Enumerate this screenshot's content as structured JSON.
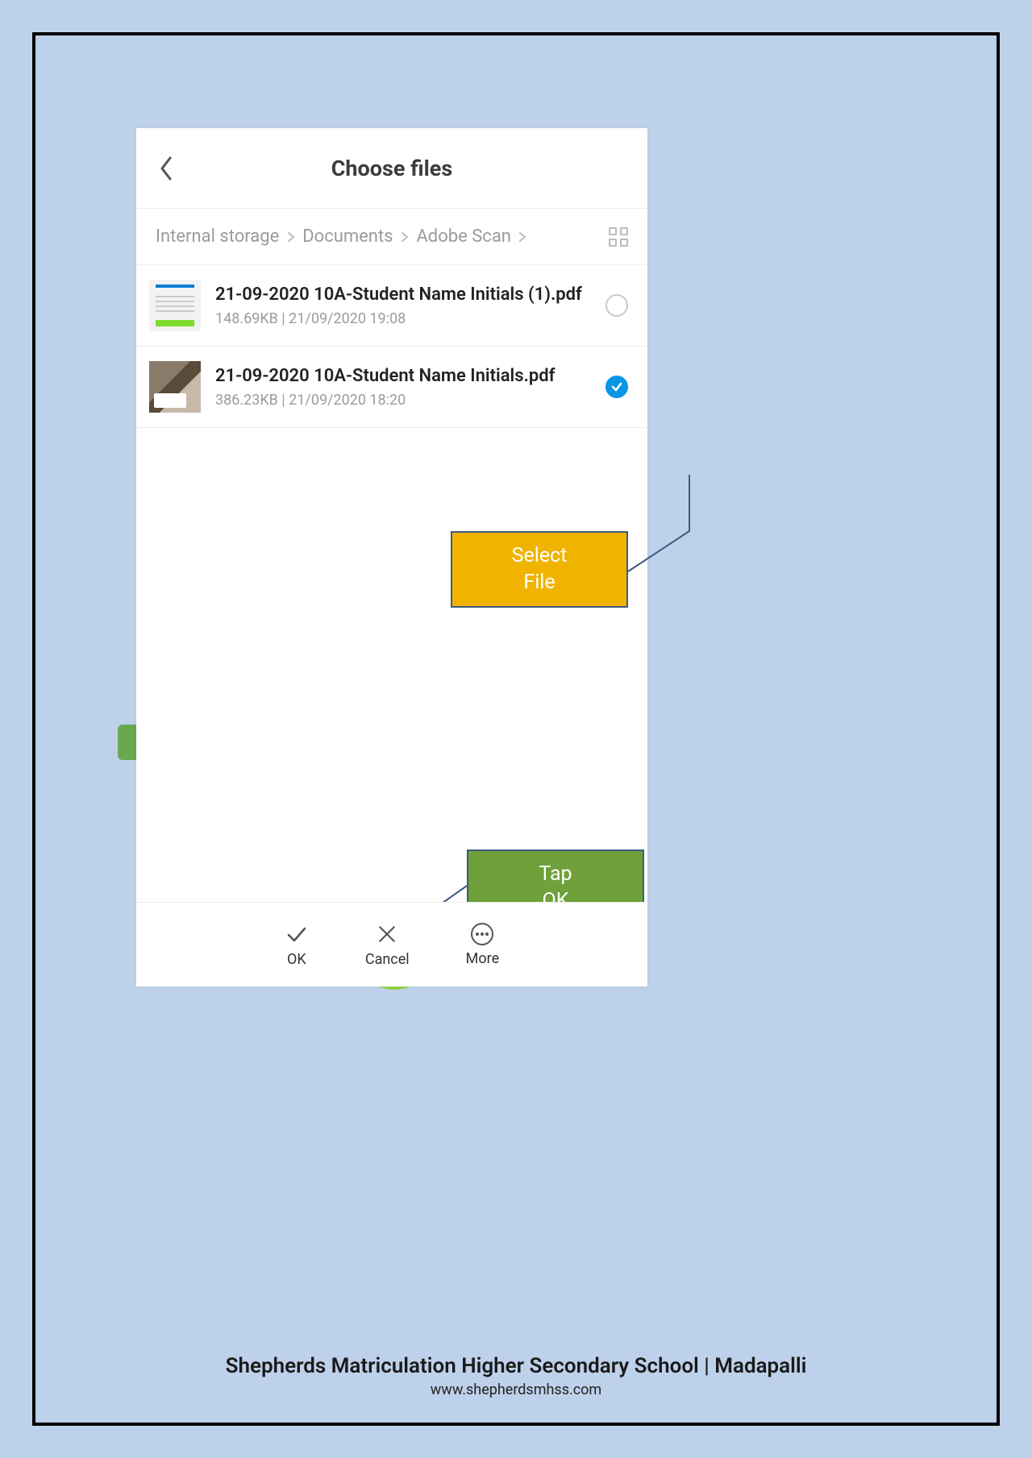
{
  "header": {
    "title": "Choose files"
  },
  "breadcrumb": {
    "parts": [
      "Internal storage",
      "Documents",
      "Adobe Scan"
    ]
  },
  "files": [
    {
      "name": "21-09-2020 10A-Student Name Initials (1).pdf",
      "size": "148.69KB",
      "date": "21/09/2020 19:08",
      "selected": false
    },
    {
      "name": "21-09-2020 10A-Student Name Initials.pdf",
      "size": "386.23KB",
      "date": "21/09/2020 18:20",
      "selected": true
    }
  ],
  "file_meta_sep": "  |  ",
  "actions": {
    "ok": "OK",
    "cancel": "Cancel",
    "more": "More"
  },
  "callouts": {
    "select": "Select\nFile",
    "tap": "Tap\nOK"
  },
  "footer": {
    "title": "Shepherds Matriculation Higher Secondary School | Madapalli",
    "url": "www.shepherdsmhss.com"
  }
}
